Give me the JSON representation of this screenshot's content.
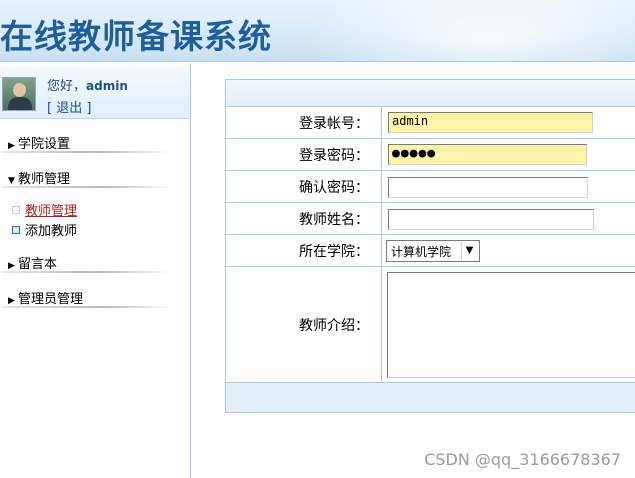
{
  "header": {
    "title": "在线教师备课系统"
  },
  "user": {
    "greeting_prefix": "您好，",
    "username": "admin",
    "logout_label": "[ 退出 ]"
  },
  "sidebar": {
    "menus": [
      {
        "label": "学院设置",
        "arrow": "▶"
      },
      {
        "label": "教师管理",
        "arrow": "▼"
      },
      {
        "label": "留言本",
        "arrow": "▶"
      },
      {
        "label": "管理员管理",
        "arrow": "▶"
      }
    ],
    "sub_items": [
      {
        "label": "教师管理",
        "active": true
      },
      {
        "label": "添加教师",
        "active": false
      }
    ]
  },
  "form": {
    "fields": [
      {
        "label": "登录帐号：",
        "value": "admin"
      },
      {
        "label": "登录密码：",
        "value": "●●●●●"
      },
      {
        "label": "确认密码：",
        "value": ""
      },
      {
        "label": "教师姓名：",
        "value": ""
      },
      {
        "label": "所在学院：",
        "value": "计算机学院"
      },
      {
        "label": "教师介绍：",
        "value": ""
      }
    ]
  },
  "watermark": "CSDN @qq_3166678367",
  "colors": {
    "accent": "#1f5f99",
    "border": "#a9c9e6",
    "highlight_input": "#fbf3a8",
    "active_link": "#b02020"
  },
  "icons": {
    "expand": "caret-right-icon",
    "collapse": "caret-down-icon",
    "dropdown": "chevron-down-icon"
  }
}
